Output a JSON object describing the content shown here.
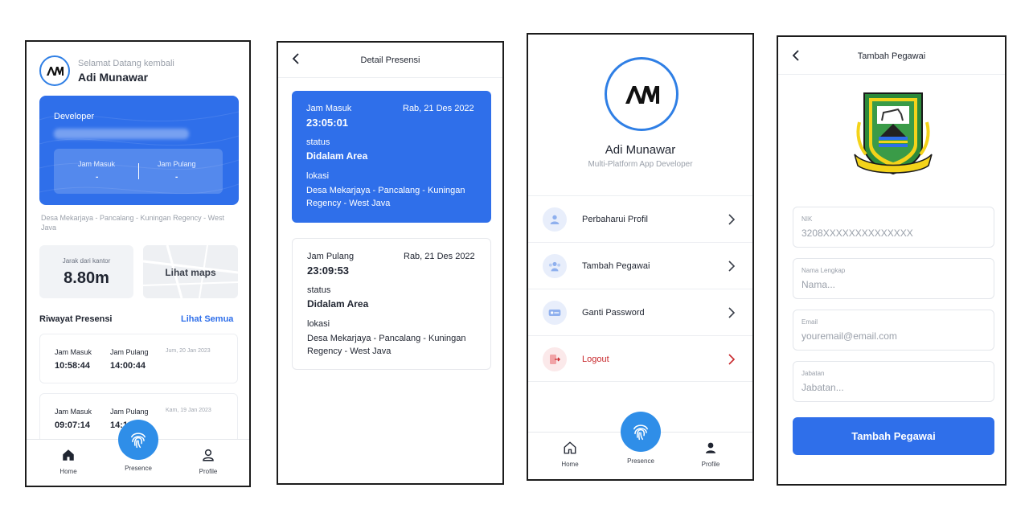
{
  "home": {
    "greeting": "Selamat Datang kembali",
    "user_name": "Adi Munawar",
    "logo_text": "AM",
    "card": {
      "role": "Developer",
      "check_in_label": "Jam Masuk",
      "check_in_value": "-",
      "check_out_label": "Jam Pulang",
      "check_out_value": "-"
    },
    "address": "Desa Mekarjaya - Pancalang - Kuningan Regency - West Java",
    "distance_label": "Jarak dari kantor",
    "distance_value": "8.80m",
    "maps_label": "Lihat maps",
    "history_title": "Riwayat Presensi",
    "see_all": "Lihat Semua",
    "history": [
      {
        "in_label": "Jam Masuk",
        "in_value": "10:58:44",
        "out_label": "Jam Pulang",
        "out_value": "14:00:44",
        "date": "Jum, 20 Jan 2023"
      },
      {
        "in_label": "Jam Masuk",
        "in_value": "09:07:14",
        "out_label": "Jam Pulang",
        "out_value": "14:1",
        "date": "Kam, 19 Jan 2023"
      }
    ],
    "nav": {
      "home": "Home",
      "presence": "Presence",
      "profile": "Profile"
    }
  },
  "detail": {
    "title": "Detail Presensi",
    "cards": [
      {
        "time_label": "Jam Masuk",
        "time": "23:05:01",
        "date": "Rab, 21 Des 2022",
        "status_label": "status",
        "status": "Didalam Area",
        "location_label": "lokasi",
        "location": "Desa Mekarjaya - Pancalang - Kuningan Regency - West Java"
      },
      {
        "time_label": "Jam Pulang",
        "time": "23:09:53",
        "date": "Rab, 21 Des 2022",
        "status_label": "status",
        "status": "Didalam Area",
        "location_label": "lokasi",
        "location": "Desa Mekarjaya - Pancalang - Kuningan Regency - West Java"
      }
    ]
  },
  "profile": {
    "logo_text": "AM",
    "name": "Adi Munawar",
    "subtitle": "Multi-Platform App Developer",
    "menu": [
      {
        "label": "Perbaharui Profil"
      },
      {
        "label": "Tambah Pegawai"
      },
      {
        "label": "Ganti Password"
      },
      {
        "label": "Logout"
      }
    ],
    "nav": {
      "home": "Home",
      "presence": "Presence",
      "profile": "Profile"
    }
  },
  "add_employee": {
    "title": "Tambah Pegawai",
    "fields": [
      {
        "label": "NIK",
        "value": "3208XXXXXXXXXXXXXX"
      },
      {
        "label": "Nama Lengkap",
        "placeholder": "Nama..."
      },
      {
        "label": "Email",
        "placeholder": "youremail@email.com"
      },
      {
        "label": "Jabatan",
        "placeholder": "Jabatan..."
      }
    ],
    "submit": "Tambah Pegawai"
  },
  "colors": {
    "primary": "#2f6fea",
    "fab": "#2f8ee8",
    "logout": "#c8282c"
  },
  "icons": [
    "logo-icon",
    "back-arrow-icon",
    "fingerprint-icon",
    "home-icon",
    "profile-icon",
    "user-edit-icon",
    "user-group-icon",
    "key-icon",
    "logout-icon",
    "chevron-right-icon",
    "regency-emblem-icon"
  ]
}
